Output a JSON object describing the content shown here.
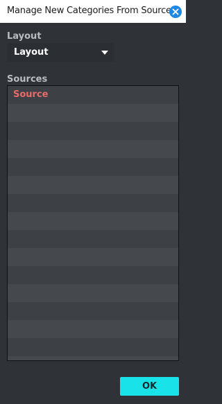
{
  "window": {
    "title": "Manage New Categories From Sources"
  },
  "layout": {
    "label": "Layout",
    "selected": "Layout"
  },
  "sources": {
    "label": "Sources",
    "items": [
      "Source",
      "",
      "",
      "",
      "",
      "",
      "",
      "",
      "",
      "",
      "",
      "",
      "",
      "",
      "",
      ""
    ]
  },
  "footer": {
    "ok_label": "OK"
  },
  "colors": {
    "background": "#2f3337",
    "accent": "#19e3e9",
    "close": "#1e88e5",
    "source_text": "#e96a6a"
  }
}
